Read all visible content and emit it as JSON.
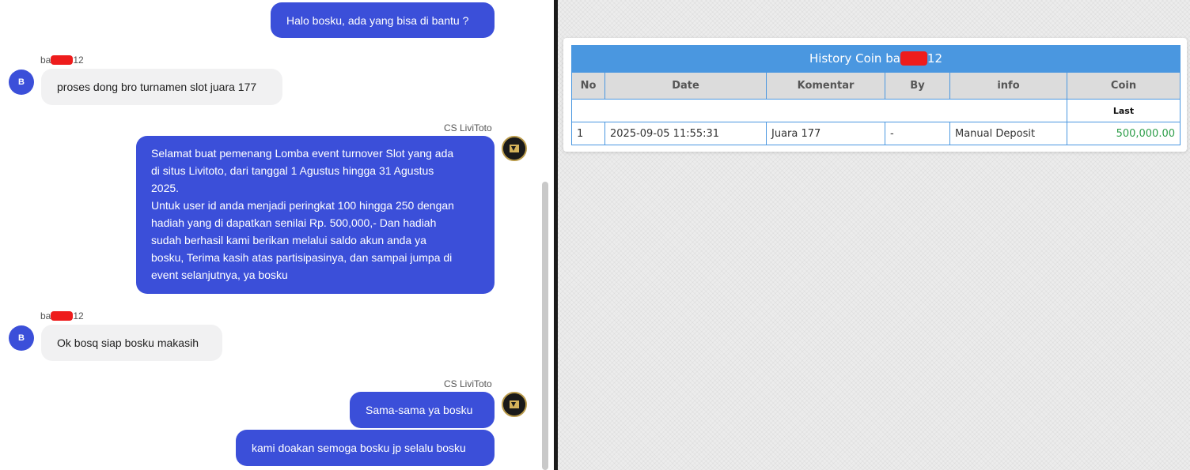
{
  "chat": {
    "messages": [
      {
        "role": "agent",
        "text": "Halo bosku, ada yang bisa di bantu ?"
      },
      {
        "role": "user",
        "sender_prefix": "ba",
        "sender_suffix": "12",
        "avatar": "B",
        "text": "proses dong bro turnamen slot juara 177"
      },
      {
        "role": "agent",
        "sender": "CS LiviToto",
        "lines": [
          "Selamat buat pemenang Lomba event turnover Slot yang ada",
          "di situs Livitoto, dari tanggal 1 Agustus hingga 31 Agustus",
          "2025.",
          "Untuk user id anda menjadi peringkat 100 hingga 250 dengan",
          "hadiah yang di dapatkan senilai Rp. 500,000,- Dan hadiah",
          "sudah berhasil kami berikan melalui saldo akun anda ya",
          "bosku, Terima kasih atas partisipasinya, dan sampai jumpa di",
          "event selanjutnya, ya bosku"
        ]
      },
      {
        "role": "user",
        "sender_prefix": "ba",
        "sender_suffix": "12",
        "avatar": "B",
        "text": "Ok bosq siap bosku makasih"
      },
      {
        "role": "agent",
        "sender": "CS LiviToto",
        "text": "Sama-sama ya bosku"
      },
      {
        "role": "agent",
        "text": "kami doakan semoga bosku jp selalu bosku"
      }
    ]
  },
  "history": {
    "title_prefix": "History Coin ba",
    "title_suffix": "12",
    "columns": [
      "No",
      "Date",
      "Komentar",
      "By",
      "info",
      "Coin"
    ],
    "sub_label": "Last",
    "rows": [
      {
        "no": "1",
        "date": "2025-09-05 11:55:31",
        "komentar": "Juara 177",
        "by": "-",
        "info": "Manual Deposit",
        "coin": "500,000.00"
      }
    ]
  },
  "colors": {
    "agent_bubble": "#3b4fd9",
    "user_bubble": "#f1f1f2",
    "table_header": "#4a97e0",
    "coin_value": "#2e9e4a",
    "redaction": "#ee1c1c"
  },
  "icons": {
    "cs_avatar": "livitoto-logo-icon",
    "user_avatar": "user-initial-avatar"
  }
}
